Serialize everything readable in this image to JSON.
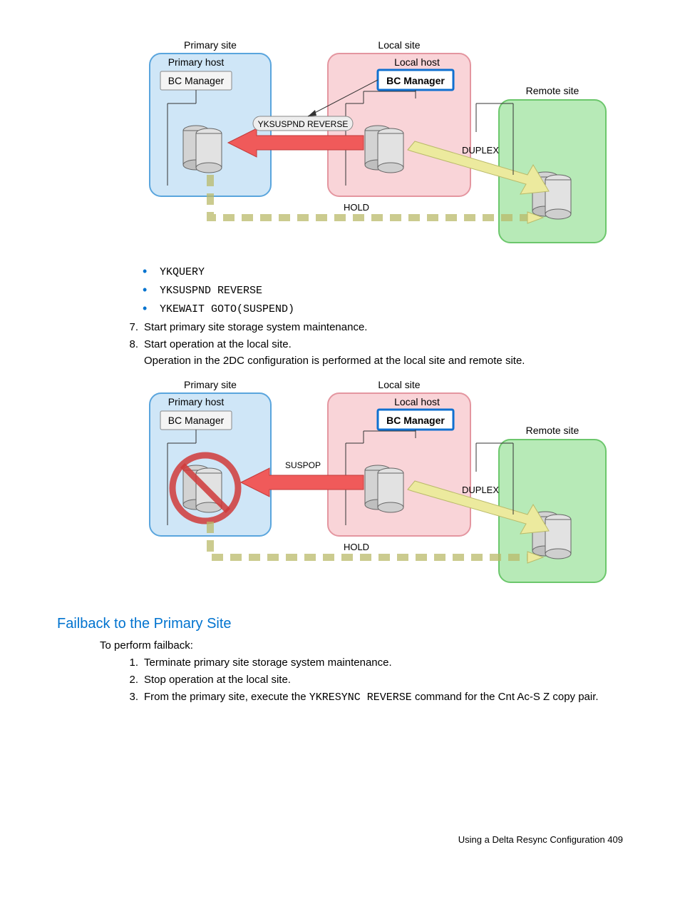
{
  "diagram1": {
    "primary_site": "Primary site",
    "primary_host": "Primary host",
    "bc_primary": "BC Manager",
    "local_site": "Local site",
    "local_host": "Local host",
    "bc_local": "BC Manager",
    "remote_site": "Remote site",
    "cmd": "YKSUSPND REVERSE",
    "duplex": "DUPLEX",
    "hold": "HOLD"
  },
  "commands": {
    "c1": "YKQUERY",
    "c2": "YKSUSPND REVERSE",
    "c3": "YKEWAIT GOTO(SUSPEND)"
  },
  "steps1": {
    "s7num": "7.",
    "s7": "Start primary site storage system maintenance.",
    "s8num": "8.",
    "s8": "Start operation at the local site.",
    "s8b": "Operation in the 2DC configuration is performed at the local site and remote site."
  },
  "diagram2": {
    "primary_site": "Primary site",
    "primary_host": "Primary host",
    "bc_primary": "BC Manager",
    "local_site": "Local site",
    "local_host": "Local host",
    "bc_local": "BC Manager",
    "remote_site": "Remote site",
    "susp": "SUSPOP",
    "duplex": "DUPLEX",
    "hold": "HOLD"
  },
  "section_title": "Failback to the Primary Site",
  "failback_intro": "To perform failback:",
  "steps2": {
    "s1num": "1.",
    "s1": "Terminate primary site storage system maintenance.",
    "s2num": "2.",
    "s2": "Stop operation at the local site.",
    "s3num": "3.",
    "s3a": "From the primary site, execute the ",
    "s3cmd": "YKRESYNC REVERSE",
    "s3b": " command for the Cnt Ac-S Z copy pair."
  },
  "footer": "Using a Delta Resync Configuration   409"
}
